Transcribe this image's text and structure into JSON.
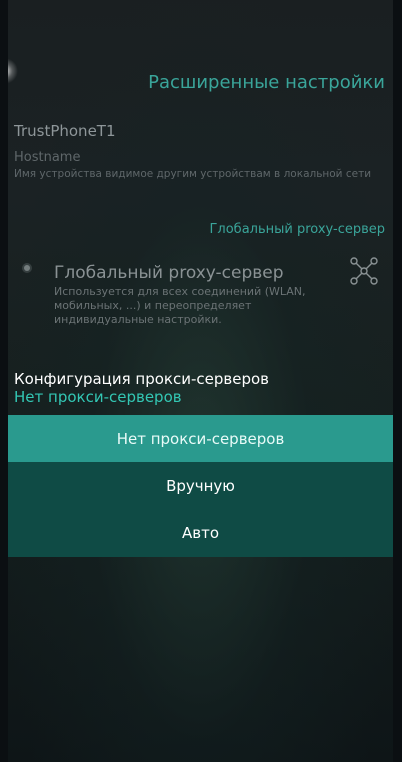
{
  "header": {
    "title": "Расширенные настройки"
  },
  "device": {
    "name": "TrustPhoneT1",
    "hostname_label": "Hostname",
    "hostname_desc": "Имя устройства видимое другим устройствам в локальной сети"
  },
  "proxy_section": {
    "title": "Глобальный proxy-сервер",
    "item_title": "Глобальный proxy-сервер",
    "item_desc": "Используется для всех соединений (WLAN, мобильных, ...) и переопределяет индивидуальные настройки.",
    "item_icon": "network-nodes-icon"
  },
  "config": {
    "label": "Конфигурация прокси-серверов",
    "value": "Нет прокси-серверов"
  },
  "menu": {
    "options": [
      {
        "label": "Нет прокси-серверов",
        "selected": true
      },
      {
        "label": "Вручную",
        "selected": false
      },
      {
        "label": "Авто",
        "selected": false
      }
    ]
  },
  "colors": {
    "accent": "#3aa59a",
    "menu_bg": "#0f4b45",
    "menu_selected": "#2a9a8e",
    "value": "#33c7b4"
  }
}
